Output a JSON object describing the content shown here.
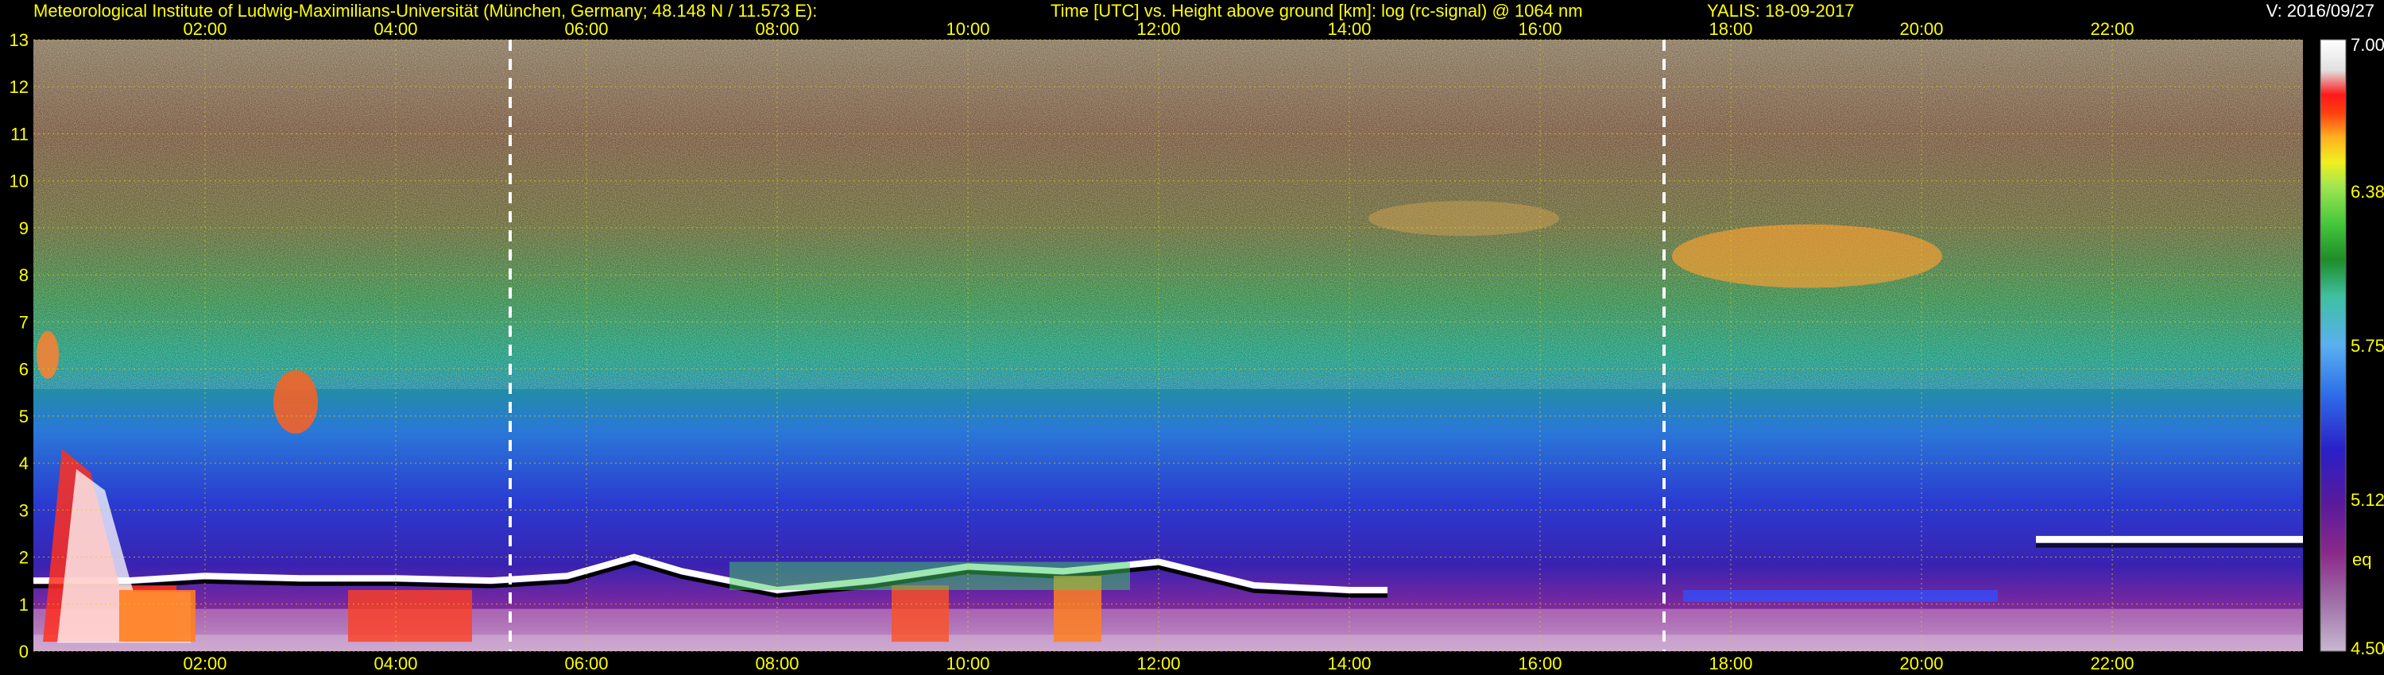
{
  "header": {
    "institution": "Meteorological Institute of Ludwig-Maximilians-Universität (München, Germany; 48.148 N / 11.573 E):",
    "title": "Time [UTC] vs. Height above ground [km]: log (rc-signal) @ 1064 nm",
    "device": "YALIS: 18-09-2017",
    "version": "V: 2016/09/27"
  },
  "colorbar": {
    "labels": [
      "7.00",
      "6.38",
      "5.75",
      "5.12",
      "4.50"
    ],
    "extra_label": "eq",
    "colors": [
      "#b8b8c8",
      "#a070a0",
      "#8a2a8a",
      "#4b1a9a",
      "#2a20c8",
      "#2e6ee8",
      "#4aa0f0",
      "#6ad0e8",
      "#2aa070",
      "#1e8c28",
      "#46c83c",
      "#9ae650",
      "#f0f020",
      "#ffb020",
      "#ff6010",
      "#ff1818",
      "#e8e8e8",
      "#ffffff"
    ]
  },
  "chart_data": {
    "type": "heatmap",
    "title": "Time [UTC] vs. Height above ground [km]: log (rc-signal) @ 1064 nm",
    "xlabel": "Time [UTC]",
    "ylabel": "Height above ground [km]",
    "x_ticks": [
      "02:00",
      "04:00",
      "06:00",
      "08:00",
      "10:00",
      "12:00",
      "14:00",
      "16:00",
      "18:00",
      "20:00",
      "22:00"
    ],
    "x_tick_hours": [
      2,
      4,
      6,
      8,
      10,
      12,
      14,
      16,
      18,
      20,
      22
    ],
    "xlim": [
      0.2,
      24.0
    ],
    "y_ticks": [
      "0",
      "1",
      "2",
      "3",
      "4",
      "5",
      "6",
      "7",
      "8",
      "9",
      "10",
      "11",
      "12",
      "13"
    ],
    "ylim": [
      0,
      13
    ],
    "color_scale": {
      "min": 4.5,
      "max": 7.0,
      "ticks": [
        7.0,
        6.38,
        5.75,
        5.12,
        4.5
      ]
    },
    "sun_markers_hours": [
      5.2,
      17.3
    ],
    "grid": true
  }
}
